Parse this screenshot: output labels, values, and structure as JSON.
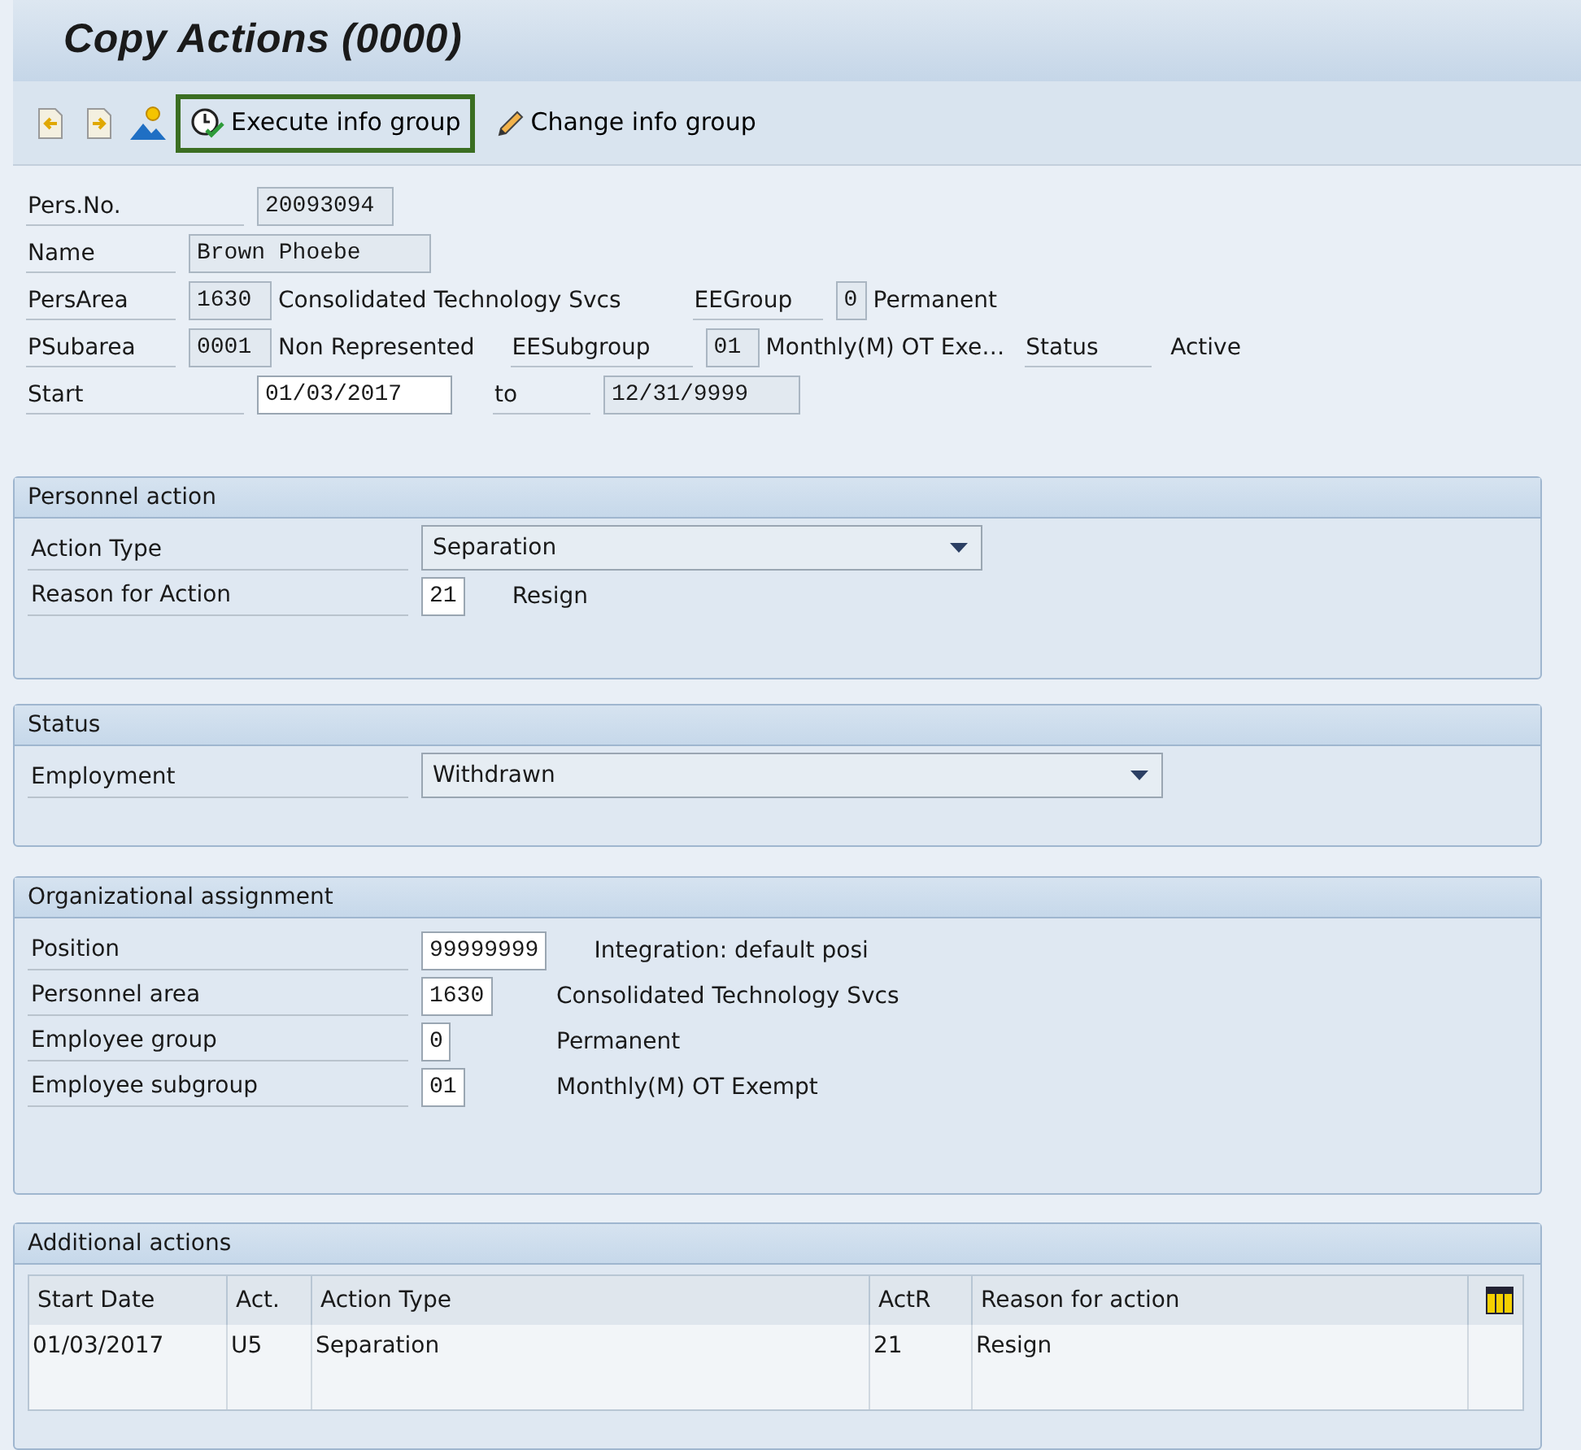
{
  "window": {
    "title": "Copy Actions (0000)"
  },
  "toolbar": [
    {
      "kind": "prev"
    },
    {
      "kind": "next"
    },
    {
      "kind": "image"
    },
    {
      "kind": "execute",
      "label": "Execute info group",
      "selected": true
    },
    {
      "kind": "change",
      "label": "Change info group",
      "selected": false
    }
  ],
  "header": [
    [
      {
        "kind": "label",
        "text": "Pers.No."
      },
      {
        "kind": "field",
        "value": "20093094",
        "editable": false
      }
    ],
    [
      {
        "kind": "label",
        "text": "Name"
      },
      {
        "kind": "field",
        "value": "Brown Phoebe",
        "editable": false
      }
    ],
    [
      {
        "kind": "label",
        "text": "PersArea"
      },
      {
        "kind": "field",
        "value": "1630",
        "editable": false
      },
      {
        "kind": "text",
        "text": "Consolidated Technology Svcs"
      },
      {
        "kind": "label",
        "text": "EEGroup"
      },
      {
        "kind": "field",
        "value": "0",
        "editable": false
      },
      {
        "kind": "text",
        "text": "Permanent"
      }
    ],
    [
      {
        "kind": "label",
        "text": "PSubarea"
      },
      {
        "kind": "field",
        "value": "0001",
        "editable": false
      },
      {
        "kind": "text",
        "text": "Non Represented"
      },
      {
        "kind": "label",
        "text": "EESubgroup"
      },
      {
        "kind": "field",
        "value": "01",
        "editable": false
      },
      {
        "kind": "text",
        "text": "Monthly(M) OT Exe…"
      },
      {
        "kind": "label",
        "text": "Status"
      },
      {
        "kind": "text",
        "text": "Active"
      }
    ],
    [
      {
        "kind": "label",
        "text": "Start"
      },
      {
        "kind": "field",
        "value": "01/03/2017",
        "editable": true
      },
      {
        "kind": "label",
        "text": "to"
      },
      {
        "kind": "field",
        "value": "12/31/9999",
        "editable": false
      }
    ]
  ],
  "groups": [
    {
      "title": "Personnel action",
      "rows": [
        {
          "label": "Action Type",
          "kind": "dropdown",
          "value": "Separation"
        },
        {
          "label": "Reason for Action",
          "kind": "field",
          "value": "21",
          "editable": true,
          "description": "Resign"
        }
      ]
    },
    {
      "title": "Status",
      "rows": [
        {
          "label": "Employment",
          "kind": "dropdown",
          "value": "Withdrawn"
        }
      ]
    },
    {
      "title": "Organizational assignment",
      "rows": [
        {
          "label": "Position",
          "kind": "field",
          "value": "99999999",
          "editable": true,
          "description": "Integration: default posi"
        },
        {
          "label": "Personnel area",
          "kind": "field",
          "value": "1630",
          "editable": true,
          "description": "Consolidated Technology Svcs"
        },
        {
          "label": "Employee group",
          "kind": "field",
          "value": "0",
          "editable": true,
          "description": "Permanent"
        },
        {
          "label": "Employee subgroup",
          "kind": "field",
          "value": "01",
          "editable": true,
          "description": "Monthly(M) OT Exempt"
        }
      ]
    }
  ],
  "additional_actions": {
    "title": "Additional actions",
    "columns": [
      "Start Date",
      "Act.",
      "Action Type",
      "ActR",
      "Reason for action"
    ],
    "rows": [
      [
        "01/03/2017",
        "U5",
        "Separation",
        "21",
        "Resign"
      ]
    ]
  }
}
